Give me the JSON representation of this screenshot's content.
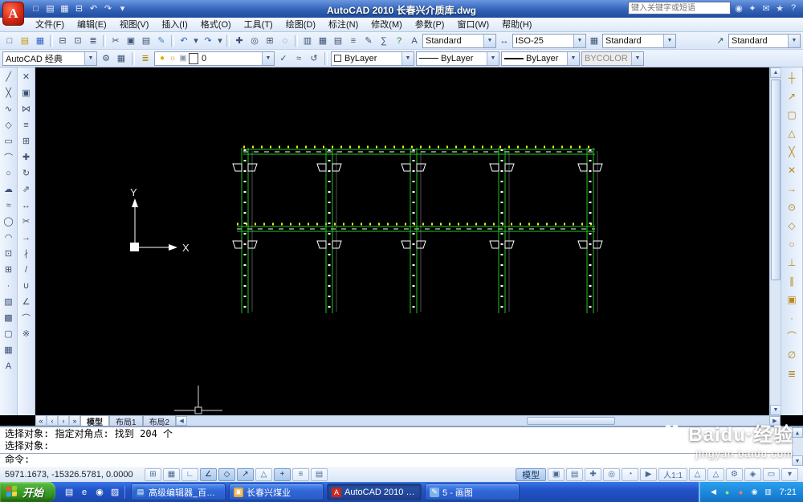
{
  "ui": {
    "chevron_down": "▼",
    "chevron_up": "▲",
    "arrow_left": "◀",
    "arrow_right": "▶",
    "tab_first": "«",
    "tab_prev": "‹",
    "tab_next": "›",
    "tab_last": "»"
  },
  "titlebar": {
    "title": "AutoCAD 2010  长春兴介质库.dwg",
    "search_placeholder": "键入关键字或短语",
    "quick_access": [
      {
        "name": "new-icon",
        "glyph": "□"
      },
      {
        "name": "open-icon",
        "glyph": "▤"
      },
      {
        "name": "save-icon",
        "glyph": "▦"
      },
      {
        "name": "plot-icon",
        "glyph": "⊟"
      },
      {
        "name": "undo-icon",
        "glyph": "↶"
      },
      {
        "name": "redo-icon",
        "glyph": "↷"
      },
      {
        "name": "qat-dropdown-icon",
        "glyph": "▾"
      }
    ],
    "infocenter_icons": [
      {
        "name": "search-icon",
        "glyph": "◉"
      },
      {
        "name": "subscription-center-icon",
        "glyph": "✦"
      },
      {
        "name": "communication-center-icon",
        "glyph": "✉"
      },
      {
        "name": "favorites-icon",
        "glyph": "★"
      },
      {
        "name": "help-icon",
        "glyph": "?"
      }
    ]
  },
  "menubar": {
    "items": [
      {
        "name": "menu-file",
        "label": "文件(F)"
      },
      {
        "name": "menu-edit",
        "label": "编辑(E)"
      },
      {
        "name": "menu-view",
        "label": "视图(V)"
      },
      {
        "name": "menu-insert",
        "label": "插入(I)"
      },
      {
        "name": "menu-format",
        "label": "格式(O)"
      },
      {
        "name": "menu-tools",
        "label": "工具(T)"
      },
      {
        "name": "menu-draw",
        "label": "绘图(D)"
      },
      {
        "name": "menu-dimension",
        "label": "标注(N)"
      },
      {
        "name": "menu-modify",
        "label": "修改(M)"
      },
      {
        "name": "menu-parametric",
        "label": "参数(P)"
      },
      {
        "name": "menu-window",
        "label": "窗口(W)"
      },
      {
        "name": "menu-help",
        "label": "帮助(H)"
      }
    ]
  },
  "toolbar1": {
    "icons": [
      {
        "name": "qnew-icon",
        "glyph": "□"
      },
      {
        "name": "open-icon",
        "glyph": "▤",
        "color": "#c8960c"
      },
      {
        "name": "save-icon",
        "glyph": "▦",
        "color": "#3462c4"
      },
      {
        "name": "separator",
        "glyph": "",
        "cls": "sep",
        "inter": false
      },
      {
        "name": "plot-icon",
        "glyph": "⊟"
      },
      {
        "name": "plot-preview-icon",
        "glyph": "⊡"
      },
      {
        "name": "publish-icon",
        "glyph": "≣"
      },
      {
        "name": "separator",
        "glyph": "",
        "cls": "sep",
        "inter": false
      },
      {
        "name": "cut-icon",
        "glyph": "✂"
      },
      {
        "name": "copy-clip-icon",
        "glyph": "▣"
      },
      {
        "name": "paste-icon",
        "glyph": "▤"
      },
      {
        "name": "match-properties-icon",
        "glyph": "✎",
        "color": "#3a87c8"
      },
      {
        "name": "separator",
        "glyph": "",
        "cls": "sep",
        "inter": false
      },
      {
        "name": "undo-icon",
        "glyph": "↶",
        "color": "#2f5fc0"
      },
      {
        "name": "undo-dropdown-icon",
        "glyph": "▾",
        "cls": "narrow"
      },
      {
        "name": "redo-icon",
        "glyph": "↷",
        "color": "#2f5fc0"
      },
      {
        "name": "redo-dropdown-icon",
        "glyph": "▾",
        "cls": "narrow"
      },
      {
        "name": "separator",
        "glyph": "",
        "cls": "sep",
        "inter": false
      },
      {
        "name": "pan-icon",
        "glyph": "✚"
      },
      {
        "name": "zoom-realtime-icon",
        "glyph": "◎"
      },
      {
        "name": "zoom-window-icon",
        "glyph": "⊞"
      },
      {
        "name": "zoom-previous-icon",
        "glyph": "◌"
      },
      {
        "name": "separator",
        "glyph": "",
        "cls": "sep",
        "inter": false
      },
      {
        "name": "properties-icon",
        "glyph": "▥"
      },
      {
        "name": "designcenter-icon",
        "glyph": "▦"
      },
      {
        "name": "tool-palettes-icon",
        "glyph": "▤"
      },
      {
        "name": "sheet-set-manager-icon",
        "glyph": "≡"
      },
      {
        "name": "markup-set-manager-icon",
        "glyph": "✎"
      },
      {
        "name": "quickcalc-icon",
        "glyph": "∑"
      },
      {
        "name": "help-icon",
        "glyph": "?",
        "color": "#2e8b2e"
      }
    ],
    "style_icons": [
      {
        "name": "text-style-icon",
        "glyph": "A"
      },
      {
        "name": "dim-style-icon",
        "glyph": "↔"
      },
      {
        "name": "table-style-icon",
        "glyph": "▦"
      },
      {
        "name": "multileader-style-icon",
        "glyph": "↗"
      }
    ],
    "text_style": "Standard",
    "dim_style": "ISO-25",
    "table_style": "Standard",
    "mleader_style": "Standard"
  },
  "toolbar2": {
    "workspace": "AutoCAD 经典",
    "workspace_icons": [
      {
        "name": "workspace-settings-icon",
        "glyph": "⚙"
      },
      {
        "name": "my-workspace-icon",
        "glyph": "▦"
      }
    ],
    "layer_icons_left": [
      {
        "name": "layer-properties-manager-icon",
        "glyph": "≣",
        "color": "#b8860b"
      }
    ],
    "layer_combo_icons": [
      {
        "name": "layer-on-icon",
        "glyph": "●",
        "color": "#e0b000"
      },
      {
        "name": "layer-freeze-icon",
        "glyph": "☼",
        "color": "#d89000"
      },
      {
        "name": "layer-lock-icon",
        "glyph": "▣",
        "color": "#8899aa"
      },
      {
        "name": "layer-color-swatch",
        "glyph": "",
        "cls": "swatch"
      }
    ],
    "layer_value": "0",
    "layer_icons_right": [
      {
        "name": "make-object-layer-current-icon",
        "glyph": "✓"
      },
      {
        "name": "layer-match-icon",
        "glyph": "≈"
      },
      {
        "name": "layer-previous-icon",
        "glyph": "↺"
      }
    ],
    "color_value": "ByLayer",
    "linetype_value": "ByLayer",
    "lineweight_value": "ByLayer",
    "plotstyle_value": "BYCOLOR"
  },
  "draw_toolbar": {
    "icons": [
      {
        "name": "line-icon",
        "glyph": "╱"
      },
      {
        "name": "construction-line-icon",
        "glyph": "╳"
      },
      {
        "name": "polyline-icon",
        "glyph": "∿"
      },
      {
        "name": "polygon-icon",
        "glyph": "◇"
      },
      {
        "name": "rectangle-icon",
        "glyph": "▭"
      },
      {
        "name": "arc-icon",
        "glyph": "⌒"
      },
      {
        "name": "circle-icon",
        "glyph": "○"
      },
      {
        "name": "revision-cloud-icon",
        "glyph": "☁"
      },
      {
        "name": "spline-icon",
        "glyph": "≈"
      },
      {
        "name": "ellipse-icon",
        "glyph": "◯"
      },
      {
        "name": "ellipse-arc-icon",
        "glyph": "◠"
      },
      {
        "name": "insert-block-icon",
        "glyph": "⊡"
      },
      {
        "name": "make-block-icon",
        "glyph": "⊞"
      },
      {
        "name": "point-icon",
        "glyph": "·"
      },
      {
        "name": "hatch-icon",
        "glyph": "▨"
      },
      {
        "name": "gradient-icon",
        "glyph": "▩"
      },
      {
        "name": "region-icon",
        "glyph": "▢"
      },
      {
        "name": "table-icon",
        "glyph": "▦"
      },
      {
        "name": "mtext-icon",
        "glyph": "A"
      }
    ]
  },
  "modify_toolbar": {
    "icons": [
      {
        "name": "erase-icon",
        "glyph": "✕"
      },
      {
        "name": "copy-icon",
        "glyph": "▣"
      },
      {
        "name": "mirror-icon",
        "glyph": "⋈"
      },
      {
        "name": "offset-icon",
        "glyph": "≡"
      },
      {
        "name": "array-icon",
        "glyph": "⊞"
      },
      {
        "name": "move-icon",
        "glyph": "✚"
      },
      {
        "name": "rotate-icon",
        "glyph": "↻"
      },
      {
        "name": "scale-icon",
        "glyph": "⇗"
      },
      {
        "name": "stretch-icon",
        "glyph": "↔"
      },
      {
        "name": "trim-icon",
        "glyph": "✂"
      },
      {
        "name": "extend-icon",
        "glyph": "→"
      },
      {
        "name": "break-at-point-icon",
        "glyph": "∤"
      },
      {
        "name": "break-icon",
        "glyph": "/"
      },
      {
        "name": "join-icon",
        "glyph": "∪"
      },
      {
        "name": "chamfer-icon",
        "glyph": "∠"
      },
      {
        "name": "fillet-icon",
        "glyph": "⌒"
      },
      {
        "name": "explode-icon",
        "glyph": "※"
      }
    ]
  },
  "osnap_toolbar": {
    "icons": [
      {
        "name": "temporary-track-point-icon",
        "glyph": "┼"
      },
      {
        "name": "snap-from-icon",
        "glyph": "↗"
      },
      {
        "name": "snap-endpoint-icon",
        "glyph": "▢"
      },
      {
        "name": "snap-midpoint-icon",
        "glyph": "△"
      },
      {
        "name": "snap-intersection-icon",
        "glyph": "╳"
      },
      {
        "name": "snap-apparent-intersection-icon",
        "glyph": "✕"
      },
      {
        "name": "snap-extension-icon",
        "glyph": "→"
      },
      {
        "name": "snap-center-icon",
        "glyph": "⊙"
      },
      {
        "name": "snap-quadrant-icon",
        "glyph": "◇"
      },
      {
        "name": "snap-tangent-icon",
        "glyph": "○"
      },
      {
        "name": "snap-perpendicular-icon",
        "glyph": "⊥"
      },
      {
        "name": "snap-parallel-icon",
        "glyph": "∥"
      },
      {
        "name": "snap-insert-icon",
        "glyph": "▣"
      },
      {
        "name": "snap-node-icon",
        "glyph": "·"
      },
      {
        "name": "snap-nearest-icon",
        "glyph": "⌒"
      },
      {
        "name": "snap-none-icon",
        "glyph": "∅"
      },
      {
        "name": "osnap-settings-icon",
        "glyph": "≣"
      }
    ]
  },
  "canvas": {
    "ucs_x_label": "X",
    "ucs_y_label": "Y"
  },
  "tabs": {
    "nav": [
      {
        "name": "first-tab-icon",
        "glyph": "«"
      },
      {
        "name": "prev-tab-icon",
        "glyph": "‹"
      },
      {
        "name": "next-tab-icon",
        "glyph": "›"
      },
      {
        "name": "last-tab-icon",
        "glyph": "»"
      }
    ],
    "items": [
      {
        "name": "tab-model",
        "label": "模型",
        "cls": "active"
      },
      {
        "name": "tab-layout1",
        "label": "布局1"
      },
      {
        "name": "tab-layout2",
        "label": "布局2"
      }
    ]
  },
  "command": {
    "lines": [
      "选择对象: 指定对角点: 找到 204 个",
      "选择对象:"
    ],
    "prompt": "命令:"
  },
  "statusbar": {
    "coords": "5971.1673, -15326.5781, 0.0000",
    "toggles": [
      {
        "name": "snap-toggle",
        "glyph": "⊞"
      },
      {
        "name": "grid-toggle",
        "glyph": "▦"
      },
      {
        "name": "ortho-toggle",
        "glyph": "∟"
      },
      {
        "name": "polar-toggle",
        "glyph": "∠",
        "cls": "on"
      },
      {
        "name": "osnap-toggle",
        "glyph": "◇",
        "cls": "on"
      },
      {
        "name": "otrack-toggle",
        "glyph": "↗",
        "cls": "on"
      },
      {
        "name": "ducs-toggle",
        "glyph": "△"
      },
      {
        "name": "dyn-toggle",
        "glyph": "+",
        "cls": "on"
      },
      {
        "name": "lwt-toggle",
        "glyph": "≡"
      },
      {
        "name": "qp-toggle",
        "glyph": "▤"
      }
    ],
    "model_label": "模型",
    "right_icons": [
      {
        "name": "quick-view-layouts-icon",
        "glyph": "▣"
      },
      {
        "name": "quick-view-drawings-icon",
        "glyph": "▤"
      },
      {
        "name": "pan-tool-icon",
        "glyph": "✚"
      },
      {
        "name": "zoom-tool-icon",
        "glyph": "◎"
      },
      {
        "name": "steering-wheel-icon",
        "glyph": "◔"
      },
      {
        "name": "show-motion-icon",
        "glyph": "▶"
      }
    ],
    "annotation_scale": "人1:1",
    "right_icons2": [
      {
        "name": "annotation-visibility-icon",
        "glyph": "△"
      },
      {
        "name": "annotation-autoscale-icon",
        "glyph": "△"
      },
      {
        "name": "workspace-switching-icon",
        "glyph": "⚙"
      },
      {
        "name": "toolbar-lock-icon",
        "glyph": "◈"
      },
      {
        "name": "clean-screen-icon",
        "glyph": "▭"
      },
      {
        "name": "status-menu-icon",
        "glyph": "▾"
      }
    ]
  },
  "taskbar": {
    "start_label": "开始",
    "quick_launch": [
      {
        "name": "show-desktop-icon",
        "glyph": "▤"
      },
      {
        "name": "ie-icon",
        "glyph": "e"
      },
      {
        "name": "media-player-icon",
        "glyph": "◉"
      },
      {
        "name": "folder-shortcut-icon",
        "glyph": "▨"
      }
    ],
    "windows": [
      {
        "label": "高级编辑器_百度...",
        "icon_glyph": "▤"
      },
      {
        "label": "长春兴煤业",
        "icon_glyph": "▣"
      },
      {
        "label": "AutoCAD 2010 - [...",
        "icon_glyph": "A"
      },
      {
        "label": "5 - 画图",
        "icon_glyph": "✎"
      }
    ],
    "tray": [
      {
        "name": "hide-tray-icons-icon",
        "glyph": "◀"
      },
      {
        "name": "safety-tray-icon",
        "glyph": "●",
        "color": "#8ef06a"
      },
      {
        "name": "im-tray-icon",
        "glyph": "●",
        "color": "#ff7a5e"
      },
      {
        "name": "volume-tray-icon",
        "glyph": "◉"
      },
      {
        "name": "network-tray-icon",
        "glyph": "▥"
      }
    ],
    "time": "7:21"
  },
  "watermark": {
    "brand": "Baidu·经验",
    "url": "jingyan.baidu.com"
  }
}
